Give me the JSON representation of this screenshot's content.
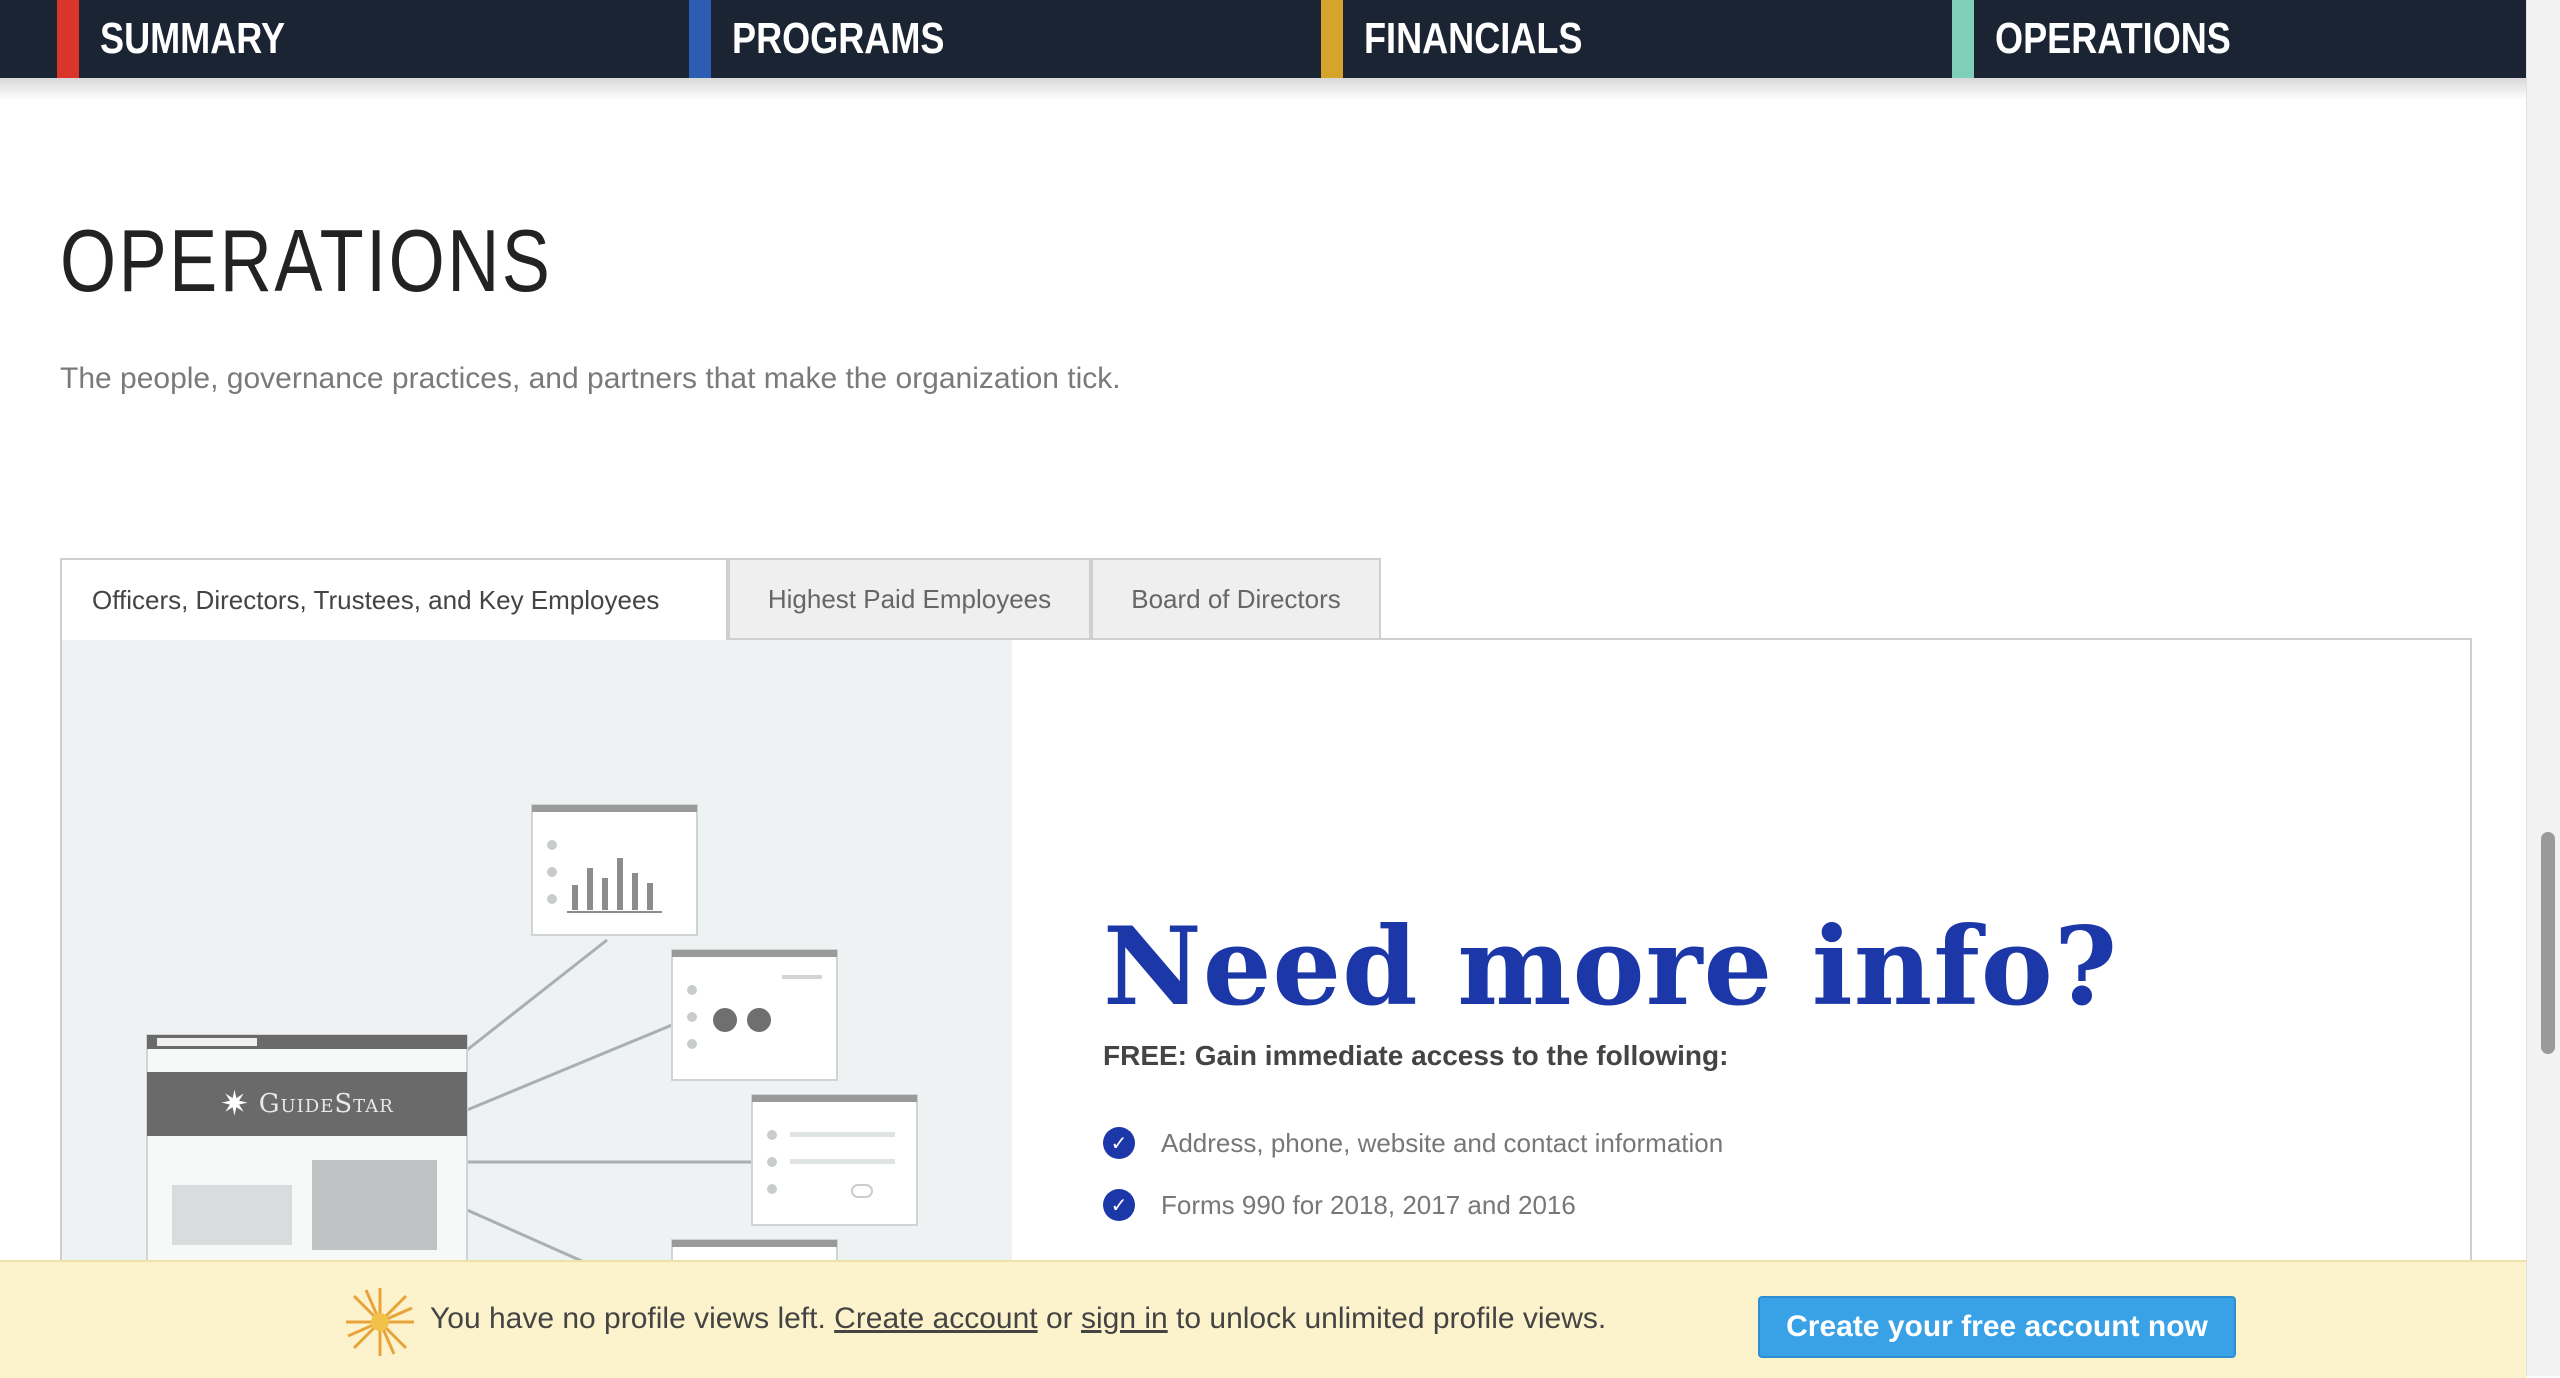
{
  "nav": {
    "tabs": [
      {
        "label": "SUMMARY",
        "color": "#d9352b"
      },
      {
        "label": "PROGRAMS",
        "color": "#2c5db3"
      },
      {
        "label": "FINANCIALS",
        "color": "#d6a42a"
      },
      {
        "label": "OPERATIONS",
        "color": "#7fcfb9"
      }
    ],
    "active": "OPERATIONS"
  },
  "section": {
    "title": "OPERATIONS",
    "subtitle": "The people, governance practices, and partners that make the organization tick."
  },
  "tabs": [
    {
      "label": "Officers, Directors, Trustees, and Key Employees",
      "active": true
    },
    {
      "label": "Highest Paid Employees",
      "active": false
    },
    {
      "label": "Board of Directors",
      "active": false
    }
  ],
  "illustration": {
    "logo_text": "GuideStar"
  },
  "promo": {
    "title": "Need more info?",
    "free_line": "FREE: Gain immediate access to the following:",
    "benefits": [
      "Address, phone, website and contact information",
      "Forms 990 for 2018, 2017 and 2016"
    ],
    "accent_color": "#1c37a8"
  },
  "banner": {
    "text_before": "You have no profile views left.",
    "create_account_link": "Create account",
    "or": "or",
    "sign_in_link": "sign in",
    "text_after": "to unlock unlimited profile views.",
    "cta_label": "Create your free account now"
  }
}
